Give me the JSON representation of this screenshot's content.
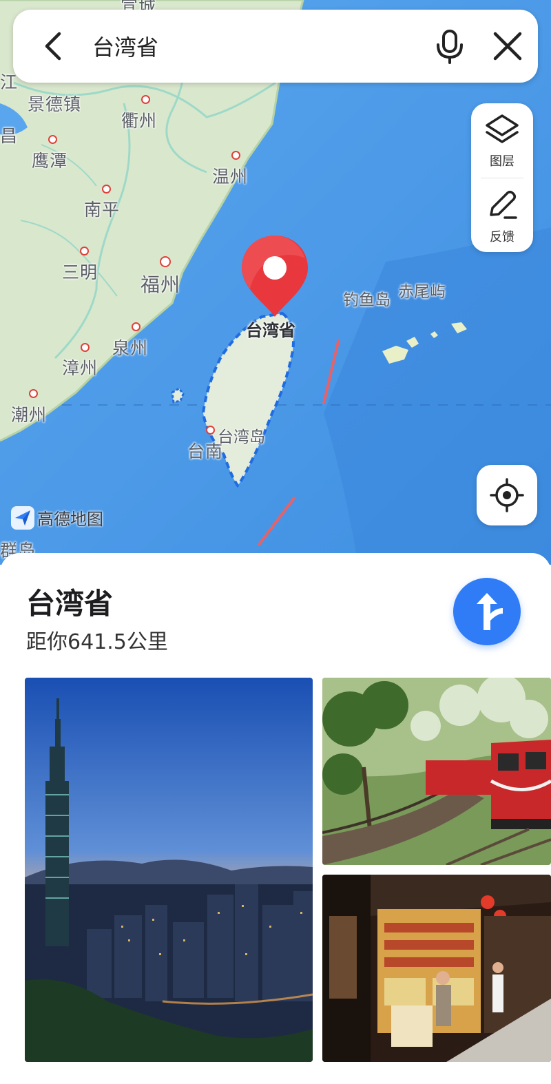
{
  "search": {
    "query": "台湾省",
    "back_icon": "chevron-left-icon",
    "mic_icon": "microphone-icon",
    "close_icon": "close-icon"
  },
  "map_controls": {
    "layers_label": "图层",
    "feedback_label": "反馈"
  },
  "map": {
    "cities": [
      "景德镇",
      "衢州",
      "鹰潭",
      "温州",
      "南平",
      "三明",
      "福州",
      "泉州",
      "漳州",
      "潮州",
      "台南"
    ],
    "top_partial_labels": [
      "宣城",
      "江",
      "昌",
      "群岛"
    ],
    "pin_label": "台湾省",
    "islands": [
      "钓鱼岛",
      "赤尾屿",
      "台湾岛"
    ],
    "logo_text": "高德地图"
  },
  "place": {
    "name": "台湾省",
    "distance": "距你641.5公里"
  },
  "colors": {
    "accent": "#2f7cf6",
    "pin": "#e8383d",
    "sea": "#4f9de8",
    "land": "#dfe9d4"
  }
}
